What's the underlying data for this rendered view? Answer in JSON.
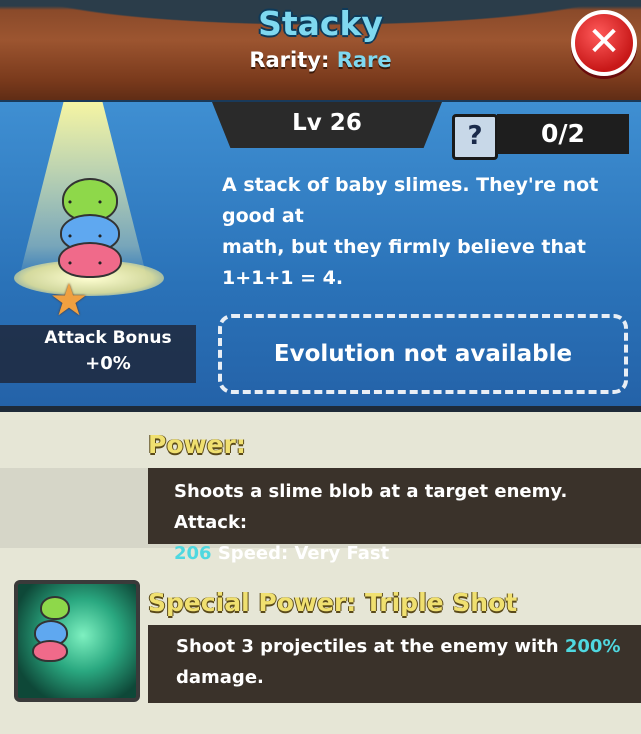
{
  "header": {
    "title": "Stacky",
    "rarity_label": "Rarity:",
    "rarity_value": "Rare"
  },
  "close_button": {
    "icon": "close-icon"
  },
  "info": {
    "level": "Lv 26",
    "help_glyph": "?",
    "count": "0/2",
    "description_line1": "A stack of baby slimes. They're not good at",
    "description_line2": "math, but they firmly believe that 1+1+1 = 4.",
    "attack_bonus_label": "Attack Bonus",
    "attack_bonus_value": "+0%",
    "evolution_text": "Evolution not available"
  },
  "power": {
    "heading": "Power:",
    "text_line1": "Shoots a slime blob at a target enemy. Attack:",
    "attack_value": "206",
    "text_line2_rest": " Speed: Very Fast"
  },
  "special": {
    "heading": "Special Power: Triple Shot",
    "text_pre": "Shoot 3 projectiles at the enemy with ",
    "highlight": "200%",
    "text_line2": "damage."
  },
  "colors": {
    "title": "#7fd8f0",
    "highlight": "#4fd8e0",
    "heading": "#f0e070",
    "close": "#d82020"
  }
}
